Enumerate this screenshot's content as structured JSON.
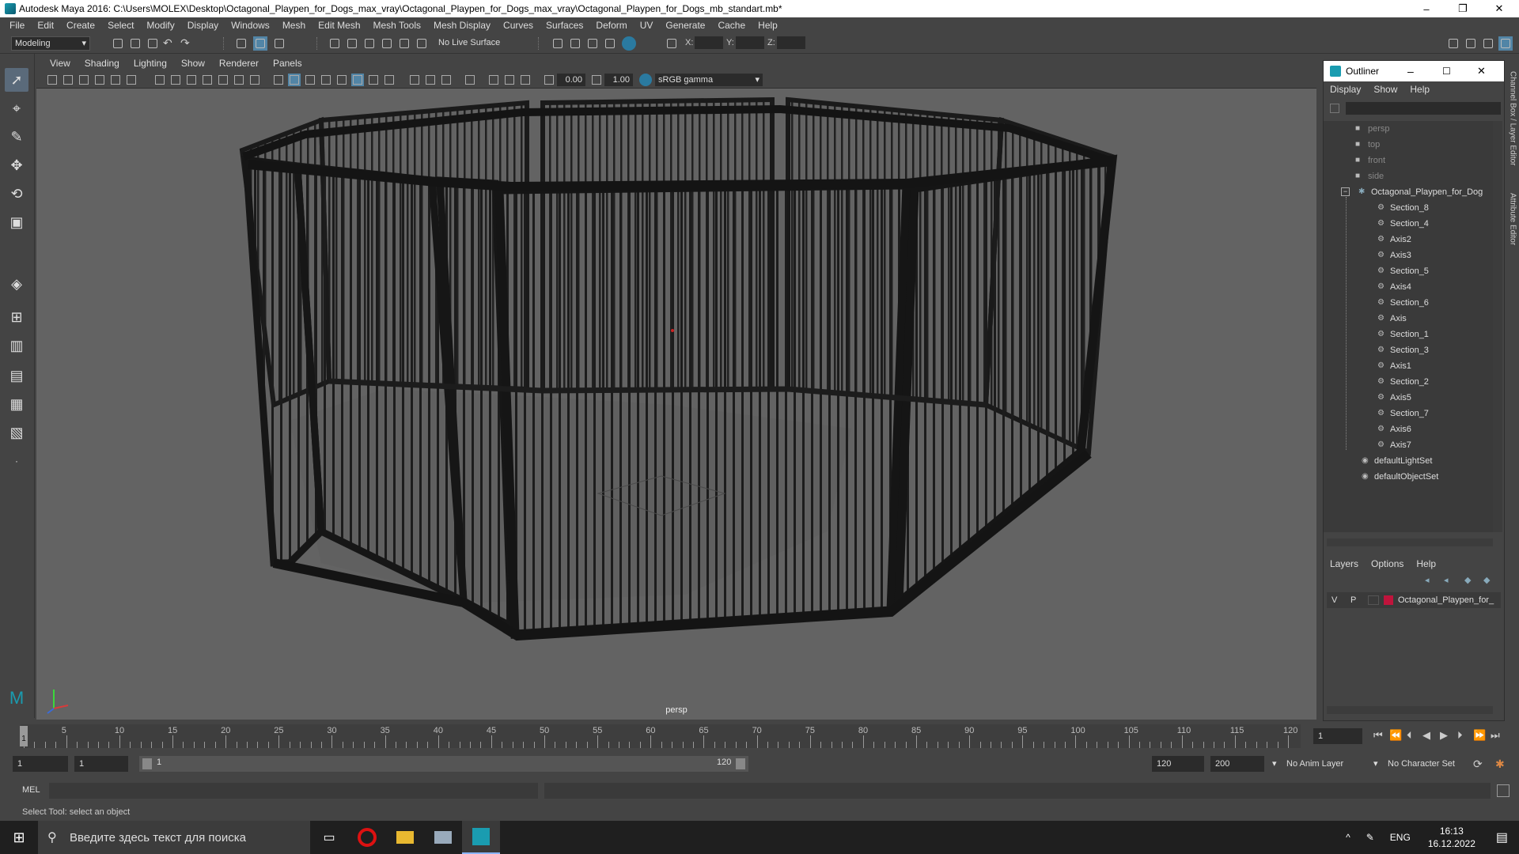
{
  "window": {
    "title": "Autodesk Maya 2016: C:\\Users\\MOLEX\\Desktop\\Octagonal_Playpen_for_Dogs_max_vray\\Octagonal_Playpen_for_Dogs_max_vray\\Octagonal_Playpen_for_Dogs_mb_standart.mb*",
    "minimize": "–",
    "maximize": "❐",
    "close": "✕"
  },
  "menubar": [
    "File",
    "Edit",
    "Create",
    "Select",
    "Modify",
    "Display",
    "Windows",
    "Mesh",
    "Edit Mesh",
    "Mesh Tools",
    "Mesh Display",
    "Curves",
    "Surfaces",
    "Deform",
    "UV",
    "Generate",
    "Cache",
    "Help"
  ],
  "statusline": {
    "mode": "Modeling",
    "live_surface": "No Live Surface",
    "x_label": "X:",
    "y_label": "Y:",
    "z_label": "Z:"
  },
  "viewport": {
    "menu": [
      "View",
      "Shading",
      "Lighting",
      "Show",
      "Renderer",
      "Panels"
    ],
    "exposure": "0.00",
    "gamma": "1.00",
    "color_space": "sRGB gamma",
    "camera_label": "persp"
  },
  "outliner": {
    "title": "Outliner",
    "menu": [
      "Display",
      "Show",
      "Help"
    ],
    "cameras": [
      "persp",
      "top",
      "front",
      "side"
    ],
    "root": "Octagonal_Playpen_for_Dog",
    "children": [
      "Section_8",
      "Section_4",
      "Axis2",
      "Axis3",
      "Section_5",
      "Axis4",
      "Section_6",
      "Axis",
      "Section_1",
      "Section_3",
      "Axis1",
      "Section_2",
      "Axis5",
      "Section_7",
      "Axis6",
      "Axis7"
    ],
    "sets": [
      "defaultLightSet",
      "defaultObjectSet"
    ]
  },
  "side_tabs": [
    "Channel Box / Layer Editor",
    "Attribute Editor"
  ],
  "layers": {
    "menu": [
      "Layers",
      "Options",
      "Help"
    ],
    "row": {
      "v": "V",
      "p": "P",
      "name": "Octagonal_Playpen_for_",
      "color": "#c0143c"
    }
  },
  "timeline": {
    "ticks": [
      5,
      10,
      15,
      20,
      25,
      30,
      35,
      40,
      45,
      50,
      55,
      60,
      65,
      70,
      75,
      80,
      85,
      90,
      95,
      100,
      105,
      110,
      115,
      120
    ],
    "current_marker": "1",
    "current_frame": "1"
  },
  "range": {
    "start": "1",
    "playback_start": "1",
    "slider_start": "1",
    "slider_end": "120",
    "playback_end": "120",
    "end": "200",
    "anim_layer": "No Anim Layer",
    "character_set": "No Character Set"
  },
  "command": {
    "label": "MEL"
  },
  "help_line": "Select Tool: select an object",
  "taskbar": {
    "search_placeholder": "Введите здесь текст для поиска",
    "language": "ENG",
    "time": "16:13",
    "date": "16.12.2022"
  },
  "colors": {
    "accent": "#5285a6",
    "viewport_bg": "#636363",
    "maya_teal": "#1a9cb0"
  }
}
